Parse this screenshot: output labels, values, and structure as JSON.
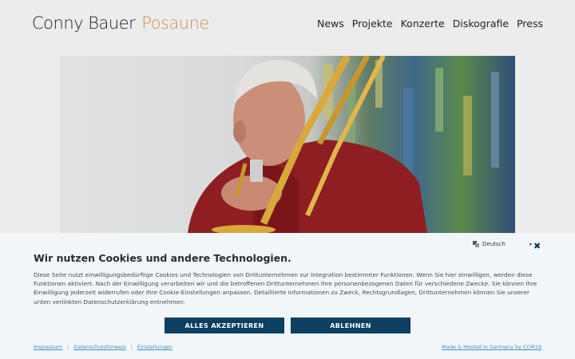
{
  "header": {
    "brand_name": "Conny Bauer",
    "brand_sub": "Posaune",
    "nav": [
      "News",
      "Projekte",
      "Konzerte",
      "Diskografie",
      "Press"
    ]
  },
  "hero": {
    "image": "trombone-player-photo"
  },
  "cookie": {
    "title": "Wir nutzen Cookies und andere Technologien.",
    "text": "Diese Seite nutzt einwilligungsbedürftige Cookies und Technologien von Drittunternehmen zur Integration bestimmter Funktionen. Wenn Sie hier einwilligen, werden diese Funktionen aktiviert. Nach der Einwilligung verarbeiten wir und die betroffenen Drittunternehmen Ihre personenbezogenen Daten für verschiedene Zwecke. Sie können Ihre Einwilligung jederzeit widerrufen oder Ihre Cookie-Einstellungen anpassen. Detaillierte Informationen zu Zweck, Rechtsgrundlagen, Drittunternehmen können Sie unserer unten verlinkten Datenschutzerklärung entnehmen.",
    "language": "Deutsch",
    "accept_label": "ALLES AKZEPTIEREN",
    "decline_label": "ABLEHNEN",
    "links": [
      "Impressum",
      "Datenschutzhinweis",
      "Einstellungen"
    ],
    "made_by": "Made & Hosted in Germany by CCM19"
  },
  "colors": {
    "accent": "#c8924f",
    "button": "#0d3f63",
    "link": "#3f8fbf",
    "banner_bg": "#f1f6f9"
  }
}
